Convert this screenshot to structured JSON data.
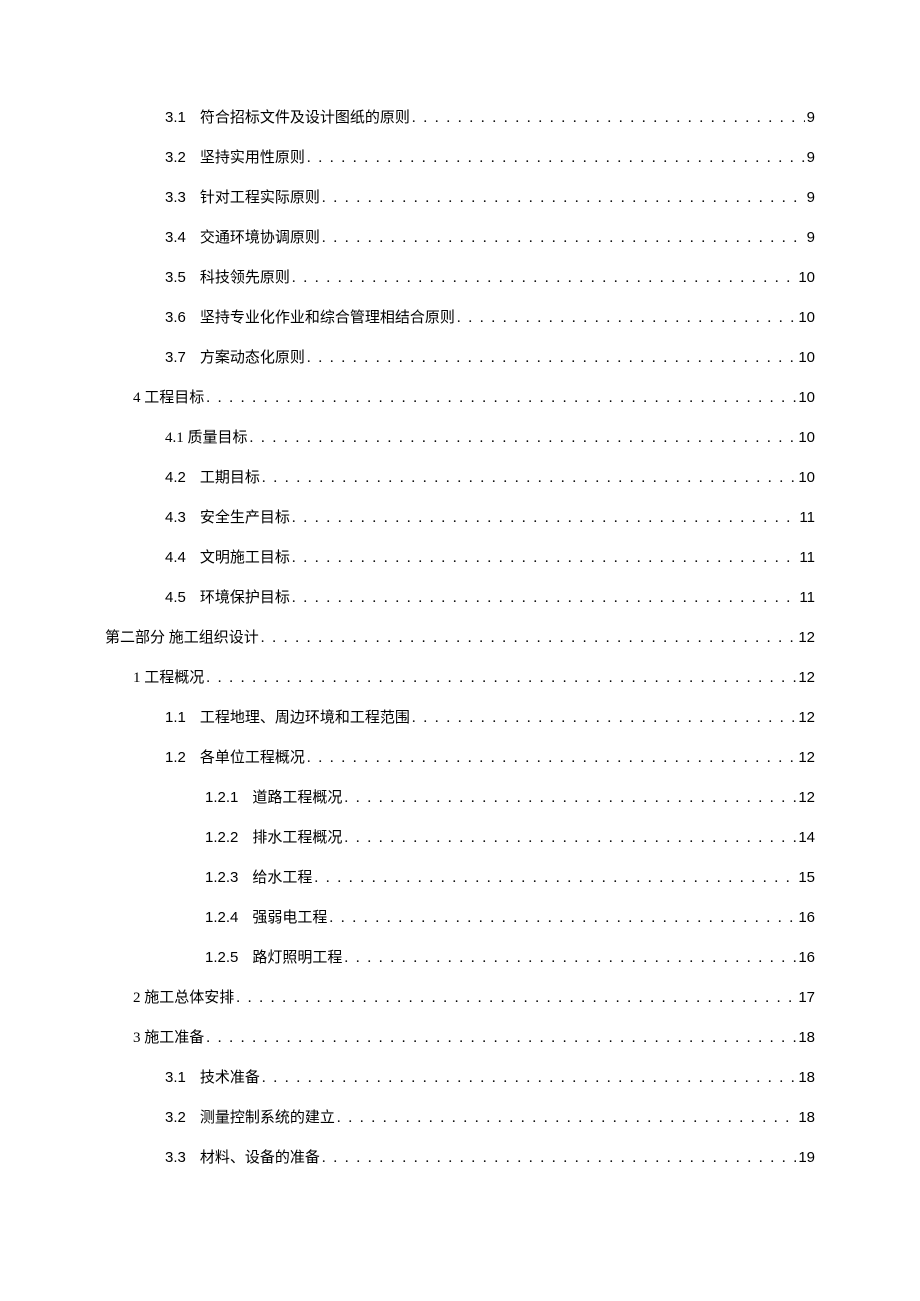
{
  "toc": [
    {
      "indent": 2,
      "num": "3.1",
      "title": "符合招标文件及设计图纸的原则",
      "page": "9"
    },
    {
      "indent": 2,
      "num": "3.2",
      "title": "坚持实用性原则",
      "page": "9"
    },
    {
      "indent": 2,
      "num": "3.3",
      "title": "针对工程实际原则",
      "page": "9"
    },
    {
      "indent": 2,
      "num": "3.4",
      "title": "交通环境协调原则",
      "page": "9"
    },
    {
      "indent": 2,
      "num": "3.5",
      "title": "科技领先原则",
      "page": "10"
    },
    {
      "indent": 2,
      "num": "3.6",
      "title": "坚持专业化作业和综合管理相结合原则",
      "page": "10"
    },
    {
      "indent": 2,
      "num": "3.7",
      "title": "方案动态化原则",
      "page": "10"
    },
    {
      "indent": 1,
      "num": "4",
      "numJoin": true,
      "title": "工程目标",
      "page": "10"
    },
    {
      "indent": 2,
      "num": "4.1",
      "numJoin": true,
      "title": "质量目标",
      "page": "10"
    },
    {
      "indent": 2,
      "num": "4.2",
      "title": "工期目标",
      "page": "10"
    },
    {
      "indent": 2,
      "num": "4.3",
      "title": "安全生产目标",
      "page": "11"
    },
    {
      "indent": 2,
      "num": "4.4",
      "title": "文明施工目标",
      "page": "11"
    },
    {
      "indent": 2,
      "num": "4.5",
      "title": "环境保护目标",
      "page": "11"
    },
    {
      "indent": 0,
      "num": "",
      "title": "第二部分 施工组织设计",
      "page": "12"
    },
    {
      "indent": 1,
      "num": "1",
      "numJoin": true,
      "title": "工程概况",
      "page": "12"
    },
    {
      "indent": 2,
      "num": "1.1",
      "title": "工程地理、周边环境和工程范围",
      "page": "12"
    },
    {
      "indent": 2,
      "num": "1.2",
      "title": "各单位工程概况",
      "page": "12"
    },
    {
      "indent": 3,
      "num": "1.2.1",
      "title": "道路工程概况",
      "page": "12"
    },
    {
      "indent": 3,
      "num": "1.2.2",
      "title": "排水工程概况",
      "page": "14"
    },
    {
      "indent": 3,
      "num": "1.2.3",
      "title": "给水工程",
      "page": "15"
    },
    {
      "indent": 3,
      "num": "1.2.4",
      "title": "强弱电工程",
      "page": "16"
    },
    {
      "indent": 3,
      "num": "1.2.5",
      "title": "路灯照明工程",
      "page": "16"
    },
    {
      "indent": 1,
      "num": "2",
      "numJoin": true,
      "title": "施工总体安排",
      "page": "17"
    },
    {
      "indent": 1,
      "num": "3",
      "numJoin": true,
      "title": "施工准备",
      "page": "18"
    },
    {
      "indent": 2,
      "num": "3.1",
      "title": "技术准备",
      "page": "18"
    },
    {
      "indent": 2,
      "num": "3.2",
      "title": "测量控制系统的建立",
      "page": "18"
    },
    {
      "indent": 2,
      "num": "3.3",
      "title": "材料、设备的准备",
      "page": "19"
    }
  ]
}
